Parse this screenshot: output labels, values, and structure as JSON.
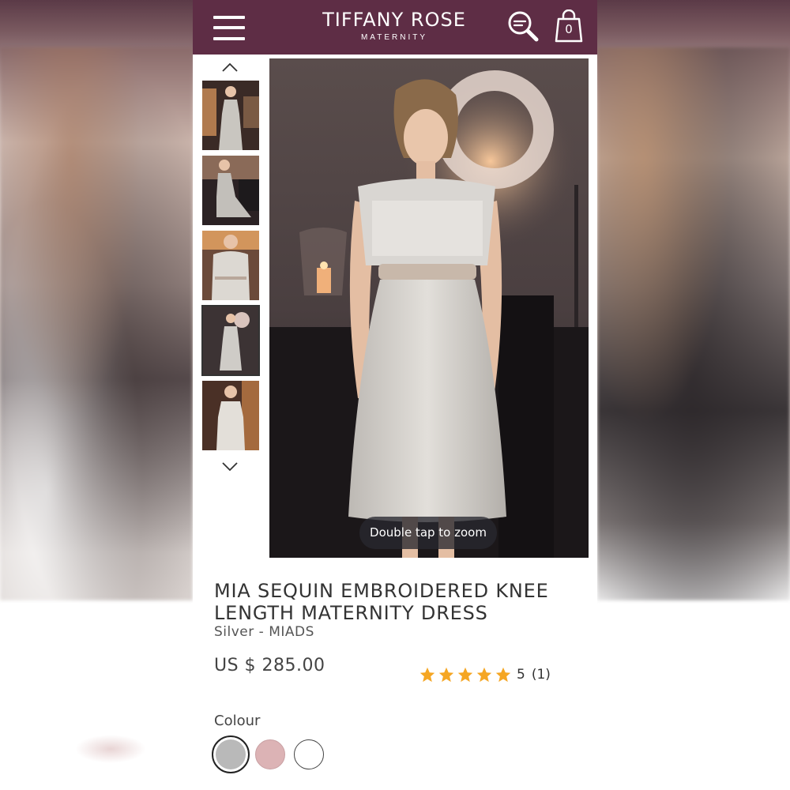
{
  "header": {
    "brand_name": "TIFFANY ROSE",
    "brand_sub": "MATERNITY",
    "cart_count": "0",
    "bg_color": "#5e2d45"
  },
  "gallery": {
    "thumbnail_count": 5,
    "active_thumbnail": 4,
    "zoom_hint": "Double tap to zoom"
  },
  "product": {
    "title": "MIA SEQUIN EMBROIDERED KNEE LENGTH MATERNITY DRESS",
    "sku": "Silver - MIADS",
    "price": "US $ 285.00",
    "rating": {
      "stars": 5,
      "value": "5",
      "count": "(1)",
      "star_color": "#f5a623"
    },
    "colour_label": "Colour",
    "colours": [
      {
        "name": "silver",
        "hex": "#b9b9b9",
        "selected": true
      },
      {
        "name": "blush",
        "hex": "#dcb3b5",
        "selected": false
      },
      {
        "name": "white",
        "hex": "#ffffff",
        "selected": false
      }
    ]
  }
}
